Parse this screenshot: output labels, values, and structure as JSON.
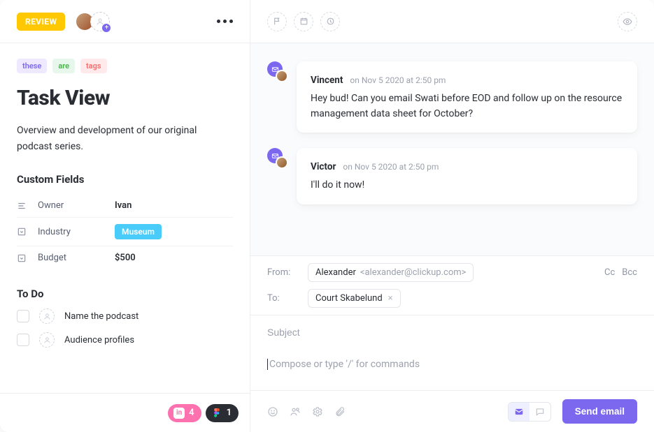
{
  "header": {
    "status": "REVIEW",
    "attachments_pink": "4",
    "attachments_dark": "1"
  },
  "tags": [
    {
      "label": "these",
      "bg": "#efe9ff",
      "fg": "#7b68ee"
    },
    {
      "label": "are",
      "bg": "#e7f7ec",
      "fg": "#4bb34b"
    },
    {
      "label": "tags",
      "bg": "#ffe9ea",
      "fg": "#ff6b6b"
    }
  ],
  "title": "Task View",
  "description": "Overview and development of our original podcast series.",
  "custom_fields_heading": "Custom Fields",
  "custom_fields": {
    "owner": {
      "label": "Owner",
      "value": "Ivan"
    },
    "industry": {
      "label": "Industry",
      "value": "Museum"
    },
    "budget": {
      "label": "Budget",
      "value": "$500"
    }
  },
  "todo_heading": "To Do",
  "todos": [
    {
      "text": "Name the podcast"
    },
    {
      "text": "Audience profiles"
    }
  ],
  "messages": [
    {
      "author": "Vincent",
      "ts": "on Nov 5 2020 at 2:50 pm",
      "body": "Hey bud! Can you email Swati before EOD and follow up on the resource management data sheet for October?"
    },
    {
      "author": "Victor",
      "ts": "on Nov 5 2020 at 2:50 pm",
      "body": "I'll do it now!"
    }
  ],
  "composer": {
    "from_label": "From:",
    "from_name": "Alexander",
    "from_email": "<alexander@clickup.com>",
    "to_label": "To:",
    "to_chip": "Court Skabelund",
    "cc": "Cc",
    "bcc": "Bcc",
    "subject_label": "Subject",
    "body_placeholder": "Compose or type '/' for commands",
    "send": "Send email"
  }
}
